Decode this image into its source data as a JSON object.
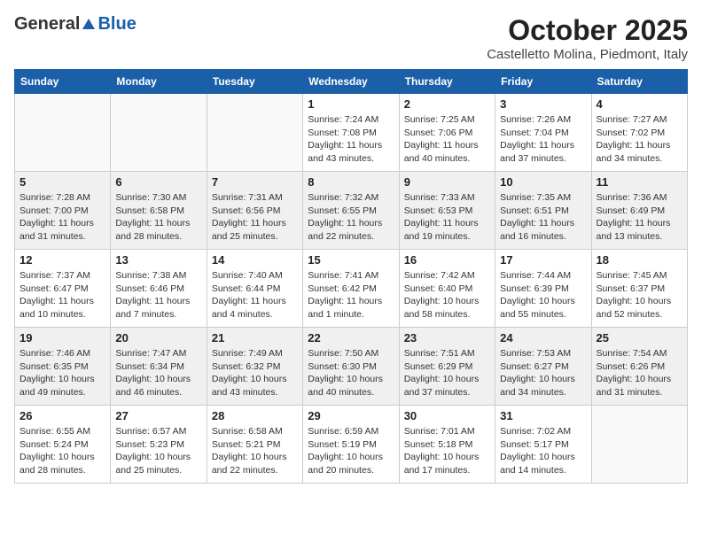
{
  "header": {
    "logo_general": "General",
    "logo_blue": "Blue",
    "month_title": "October 2025",
    "subtitle": "Castelletto Molina, Piedmont, Italy"
  },
  "days_of_week": [
    "Sunday",
    "Monday",
    "Tuesday",
    "Wednesday",
    "Thursday",
    "Friday",
    "Saturday"
  ],
  "weeks": [
    {
      "shaded": false,
      "days": [
        {
          "num": "",
          "info": ""
        },
        {
          "num": "",
          "info": ""
        },
        {
          "num": "",
          "info": ""
        },
        {
          "num": "1",
          "info": "Sunrise: 7:24 AM\nSunset: 7:08 PM\nDaylight: 11 hours and 43 minutes."
        },
        {
          "num": "2",
          "info": "Sunrise: 7:25 AM\nSunset: 7:06 PM\nDaylight: 11 hours and 40 minutes."
        },
        {
          "num": "3",
          "info": "Sunrise: 7:26 AM\nSunset: 7:04 PM\nDaylight: 11 hours and 37 minutes."
        },
        {
          "num": "4",
          "info": "Sunrise: 7:27 AM\nSunset: 7:02 PM\nDaylight: 11 hours and 34 minutes."
        }
      ]
    },
    {
      "shaded": true,
      "days": [
        {
          "num": "5",
          "info": "Sunrise: 7:28 AM\nSunset: 7:00 PM\nDaylight: 11 hours and 31 minutes."
        },
        {
          "num": "6",
          "info": "Sunrise: 7:30 AM\nSunset: 6:58 PM\nDaylight: 11 hours and 28 minutes."
        },
        {
          "num": "7",
          "info": "Sunrise: 7:31 AM\nSunset: 6:56 PM\nDaylight: 11 hours and 25 minutes."
        },
        {
          "num": "8",
          "info": "Sunrise: 7:32 AM\nSunset: 6:55 PM\nDaylight: 11 hours and 22 minutes."
        },
        {
          "num": "9",
          "info": "Sunrise: 7:33 AM\nSunset: 6:53 PM\nDaylight: 11 hours and 19 minutes."
        },
        {
          "num": "10",
          "info": "Sunrise: 7:35 AM\nSunset: 6:51 PM\nDaylight: 11 hours and 16 minutes."
        },
        {
          "num": "11",
          "info": "Sunrise: 7:36 AM\nSunset: 6:49 PM\nDaylight: 11 hours and 13 minutes."
        }
      ]
    },
    {
      "shaded": false,
      "days": [
        {
          "num": "12",
          "info": "Sunrise: 7:37 AM\nSunset: 6:47 PM\nDaylight: 11 hours and 10 minutes."
        },
        {
          "num": "13",
          "info": "Sunrise: 7:38 AM\nSunset: 6:46 PM\nDaylight: 11 hours and 7 minutes."
        },
        {
          "num": "14",
          "info": "Sunrise: 7:40 AM\nSunset: 6:44 PM\nDaylight: 11 hours and 4 minutes."
        },
        {
          "num": "15",
          "info": "Sunrise: 7:41 AM\nSunset: 6:42 PM\nDaylight: 11 hours and 1 minute."
        },
        {
          "num": "16",
          "info": "Sunrise: 7:42 AM\nSunset: 6:40 PM\nDaylight: 10 hours and 58 minutes."
        },
        {
          "num": "17",
          "info": "Sunrise: 7:44 AM\nSunset: 6:39 PM\nDaylight: 10 hours and 55 minutes."
        },
        {
          "num": "18",
          "info": "Sunrise: 7:45 AM\nSunset: 6:37 PM\nDaylight: 10 hours and 52 minutes."
        }
      ]
    },
    {
      "shaded": true,
      "days": [
        {
          "num": "19",
          "info": "Sunrise: 7:46 AM\nSunset: 6:35 PM\nDaylight: 10 hours and 49 minutes."
        },
        {
          "num": "20",
          "info": "Sunrise: 7:47 AM\nSunset: 6:34 PM\nDaylight: 10 hours and 46 minutes."
        },
        {
          "num": "21",
          "info": "Sunrise: 7:49 AM\nSunset: 6:32 PM\nDaylight: 10 hours and 43 minutes."
        },
        {
          "num": "22",
          "info": "Sunrise: 7:50 AM\nSunset: 6:30 PM\nDaylight: 10 hours and 40 minutes."
        },
        {
          "num": "23",
          "info": "Sunrise: 7:51 AM\nSunset: 6:29 PM\nDaylight: 10 hours and 37 minutes."
        },
        {
          "num": "24",
          "info": "Sunrise: 7:53 AM\nSunset: 6:27 PM\nDaylight: 10 hours and 34 minutes."
        },
        {
          "num": "25",
          "info": "Sunrise: 7:54 AM\nSunset: 6:26 PM\nDaylight: 10 hours and 31 minutes."
        }
      ]
    },
    {
      "shaded": false,
      "days": [
        {
          "num": "26",
          "info": "Sunrise: 6:55 AM\nSunset: 5:24 PM\nDaylight: 10 hours and 28 minutes."
        },
        {
          "num": "27",
          "info": "Sunrise: 6:57 AM\nSunset: 5:23 PM\nDaylight: 10 hours and 25 minutes."
        },
        {
          "num": "28",
          "info": "Sunrise: 6:58 AM\nSunset: 5:21 PM\nDaylight: 10 hours and 22 minutes."
        },
        {
          "num": "29",
          "info": "Sunrise: 6:59 AM\nSunset: 5:19 PM\nDaylight: 10 hours and 20 minutes."
        },
        {
          "num": "30",
          "info": "Sunrise: 7:01 AM\nSunset: 5:18 PM\nDaylight: 10 hours and 17 minutes."
        },
        {
          "num": "31",
          "info": "Sunrise: 7:02 AM\nSunset: 5:17 PM\nDaylight: 10 hours and 14 minutes."
        },
        {
          "num": "",
          "info": ""
        }
      ]
    }
  ]
}
